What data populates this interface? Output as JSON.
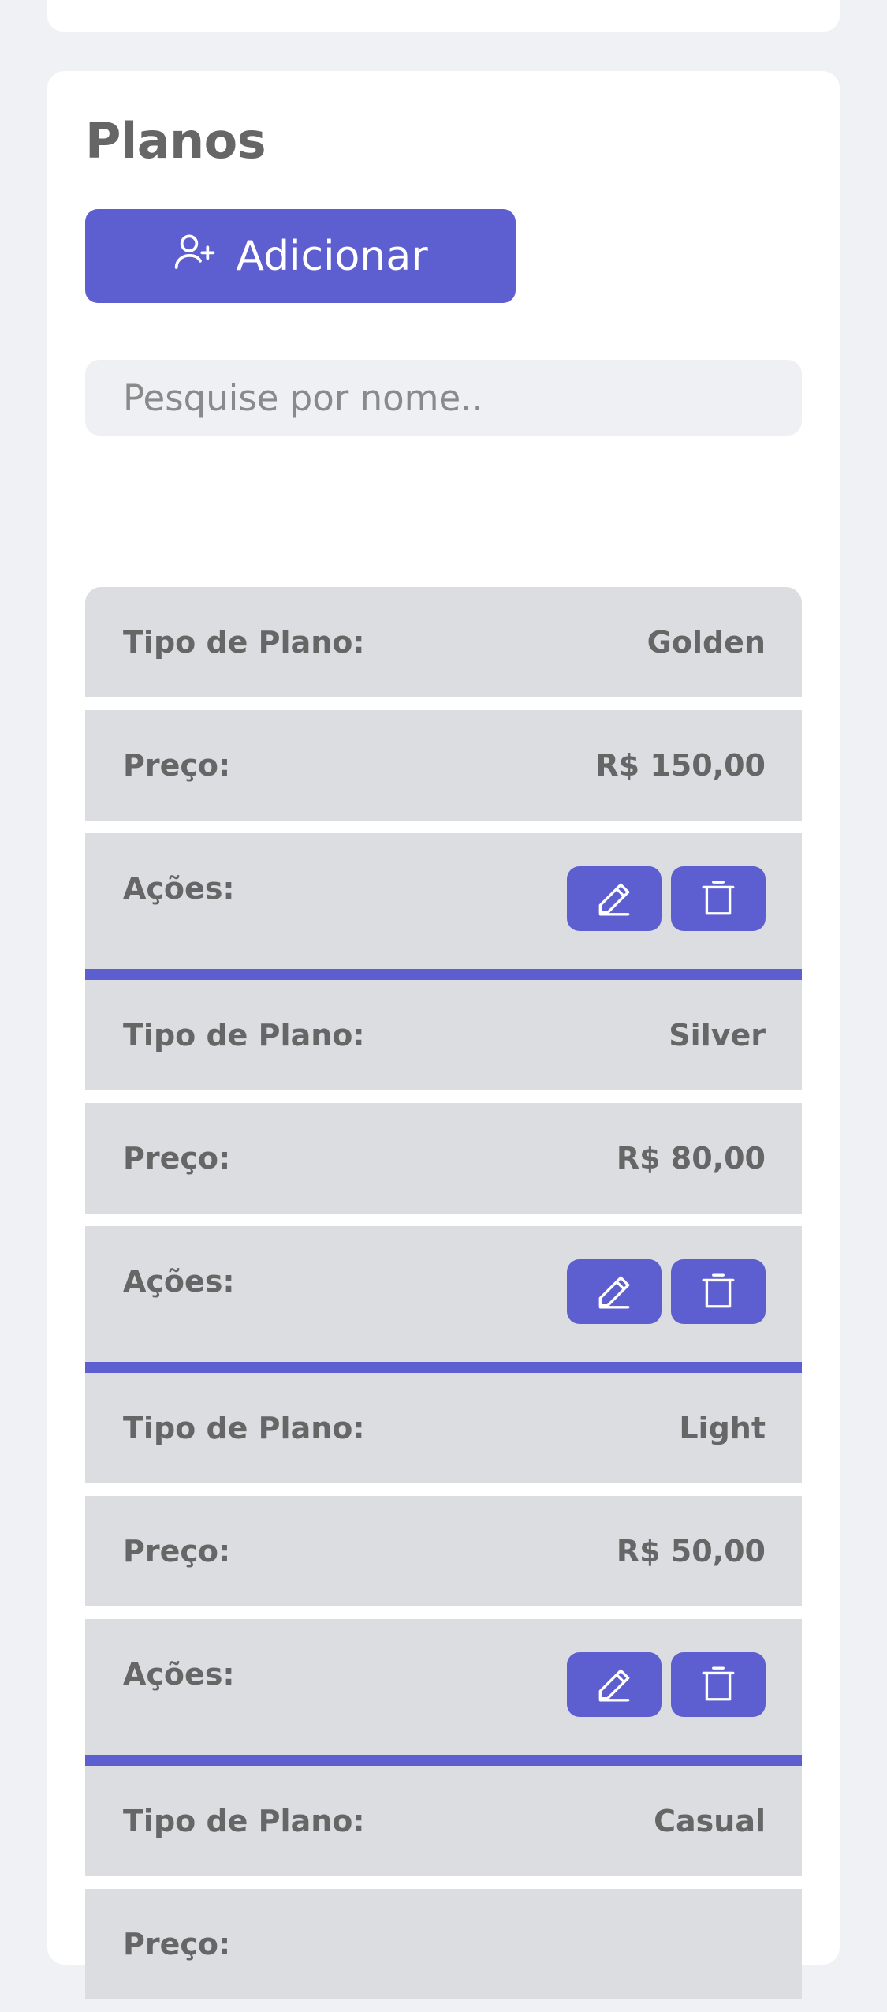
{
  "page": {
    "title": "Planos",
    "add_label": "Adicionar",
    "search_placeholder": "Pesquise por nome.."
  },
  "labels": {
    "plan_type": "Tipo de Plano:",
    "price": "Preço:",
    "actions": "Ações:"
  },
  "plans": [
    {
      "type": "Golden",
      "price": "R$ 150,00"
    },
    {
      "type": "Silver",
      "price": "R$ 80,00"
    },
    {
      "type": "Light",
      "price": "R$ 50,00"
    },
    {
      "type": "Casual",
      "price": ""
    }
  ],
  "colors": {
    "accent": "#5d5fd0",
    "row_bg": "#dcdde1",
    "page_bg": "#f0f1f5",
    "text": "#666666"
  },
  "icons": {
    "add": "user-plus-icon",
    "edit": "pencil-icon",
    "delete": "trash-icon"
  }
}
